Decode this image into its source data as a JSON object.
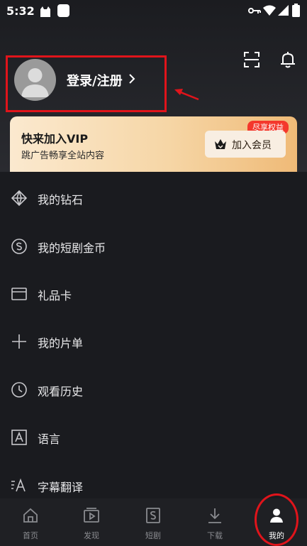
{
  "status_bar": {
    "time": "5:32"
  },
  "header": {
    "login_label": "登录/注册"
  },
  "vip": {
    "title": "快来加入VIP",
    "subtitle": "跳广告畅享全站内容",
    "badge": "尽享权益",
    "join_label": "加入会员"
  },
  "menu": {
    "items": [
      {
        "label": "我的钻石",
        "icon": "diamond-icon"
      },
      {
        "label": "我的短剧金币",
        "icon": "coin-icon"
      },
      {
        "label": "礼品卡",
        "icon": "gift-card-icon"
      },
      {
        "label": "我的片单",
        "icon": "plus-icon"
      },
      {
        "label": "观看历史",
        "icon": "clock-icon"
      },
      {
        "label": "语言",
        "icon": "language-icon"
      },
      {
        "label": "字幕翻译",
        "icon": "subtitle-icon"
      }
    ]
  },
  "bottom_nav": {
    "items": [
      {
        "label": "首页",
        "icon": "home-icon"
      },
      {
        "label": "发现",
        "icon": "discover-icon"
      },
      {
        "label": "短剧",
        "icon": "short-drama-icon"
      },
      {
        "label": "下载",
        "icon": "download-icon"
      },
      {
        "label": "我的",
        "icon": "profile-icon"
      }
    ],
    "active": "我的"
  },
  "colors": {
    "accent_red": "#e0141b",
    "vip_gold": "#f6d6a6",
    "badge_red": "#f4382c"
  }
}
